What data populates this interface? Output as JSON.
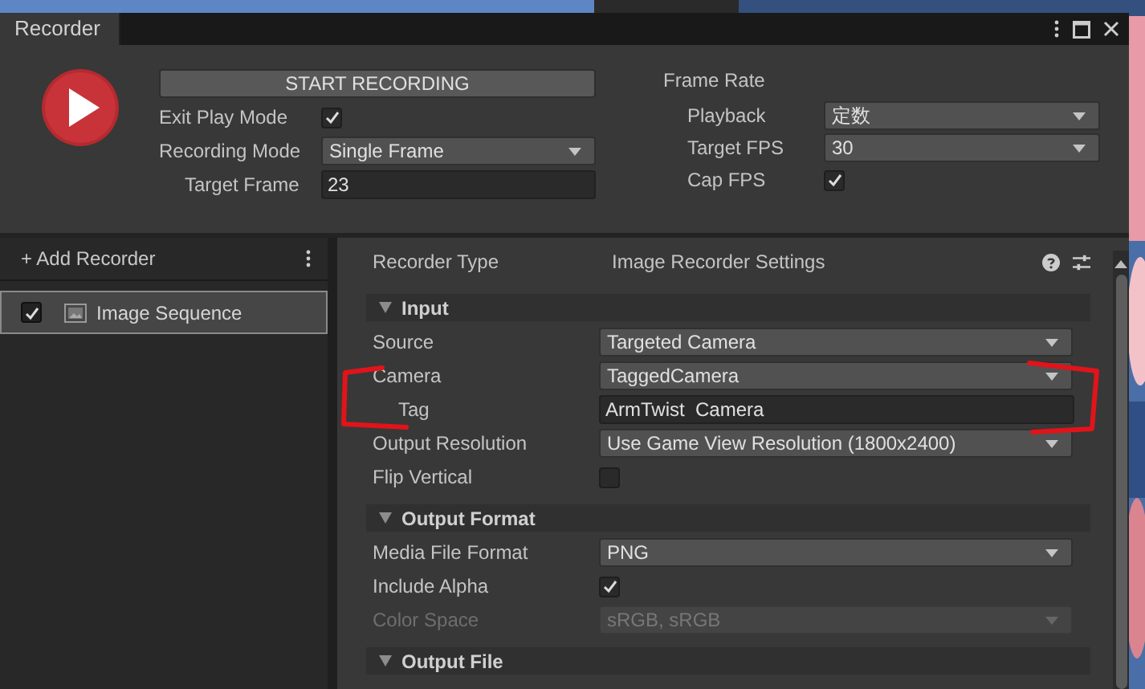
{
  "window": {
    "title": "Recorder"
  },
  "start_button": "START RECORDING",
  "recording": [
    {
      "label": "Exit Play Mode",
      "kind": "checkbox",
      "checked": true,
      "indented": false
    },
    {
      "label": "Recording Mode",
      "kind": "dropdown",
      "value": "Single Frame",
      "indented": false
    },
    {
      "label": "Target Frame",
      "kind": "text",
      "value": "23",
      "indented": true
    }
  ],
  "frame_rate": {
    "title": "Frame Rate",
    "fields": [
      {
        "label": "Playback",
        "kind": "dropdown",
        "value": "定数"
      },
      {
        "label": "Target FPS",
        "kind": "dropdown",
        "value": "30"
      },
      {
        "label": "Cap FPS",
        "kind": "checkbox",
        "checked": true
      }
    ]
  },
  "sidebar": {
    "add_label": "+ Add Recorder",
    "items": [
      {
        "label": "Image Sequence",
        "checked": true,
        "selected": true
      }
    ]
  },
  "settings": {
    "type_label": "Recorder Type",
    "type_value": "Image Recorder Settings",
    "sections": [
      {
        "title": "Input",
        "expanded": true,
        "fields": [
          {
            "label": "Source",
            "kind": "dropdown",
            "value": "Targeted Camera",
            "indented": false,
            "disabled": false
          },
          {
            "label": "Camera",
            "kind": "dropdown",
            "value": "TaggedCamera",
            "indented": false,
            "disabled": false
          },
          {
            "label": "Tag",
            "kind": "text",
            "value": "ArmTwist  Camera",
            "indented": true,
            "disabled": false
          },
          {
            "label": "Output Resolution",
            "kind": "dropdown",
            "value": "Use Game View Resolution (1800x2400)",
            "indented": false,
            "disabled": false
          },
          {
            "label": "Flip Vertical",
            "kind": "checkbox",
            "checked": false,
            "indented": false,
            "disabled": false
          }
        ]
      },
      {
        "title": "Output Format",
        "expanded": true,
        "fields": [
          {
            "label": "Media File Format",
            "kind": "dropdown",
            "value": "PNG",
            "indented": false,
            "disabled": false
          },
          {
            "label": "Include Alpha",
            "kind": "checkbox",
            "checked": true,
            "indented": false,
            "disabled": false
          },
          {
            "label": "Color Space",
            "kind": "dropdown",
            "value": "sRGB, sRGB",
            "indented": false,
            "disabled": true
          }
        ]
      },
      {
        "title": "Output File",
        "expanded": true
      }
    ]
  }
}
